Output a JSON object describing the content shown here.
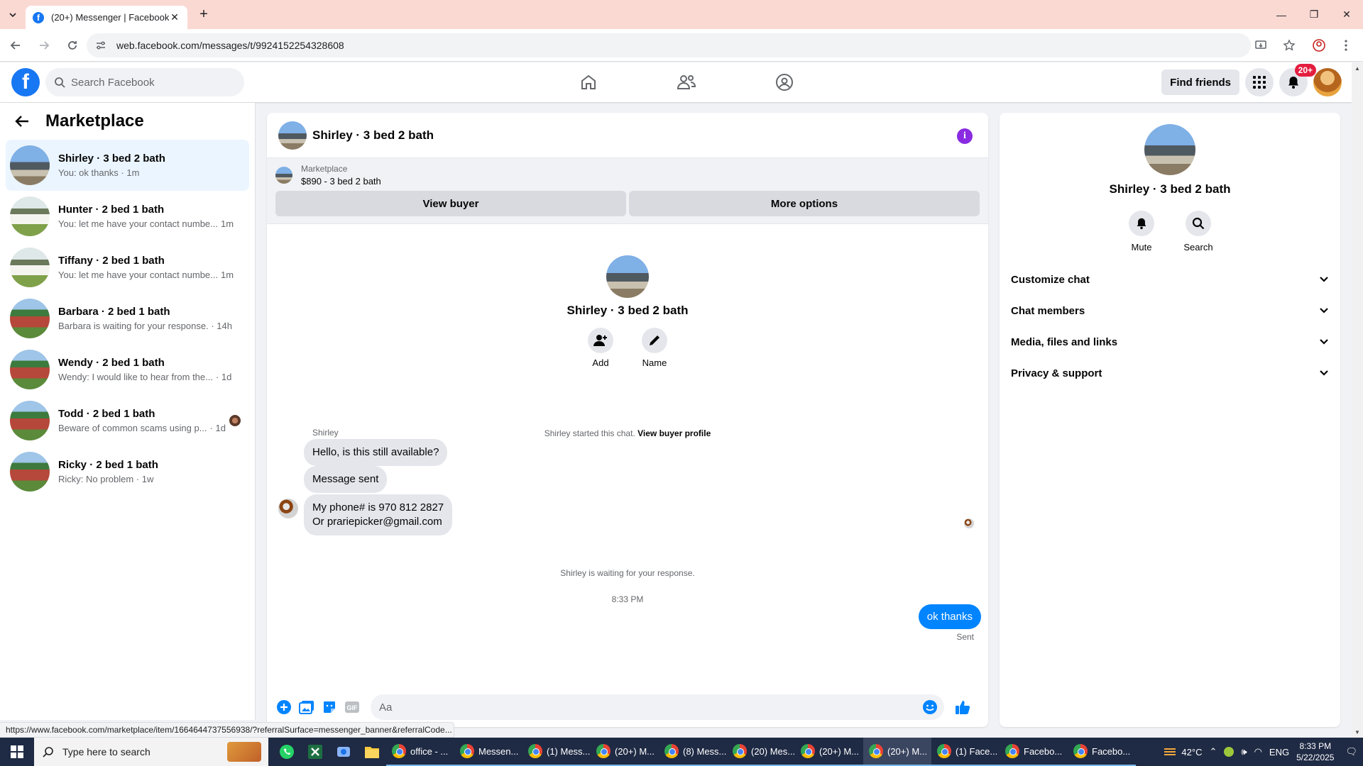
{
  "browser": {
    "tab_title": "(20+) Messenger | Facebook",
    "url": "web.facebook.com/messages/t/9924152254328608"
  },
  "header": {
    "search_placeholder": "Search Facebook",
    "find_friends": "Find friends",
    "notifications_badge": "20+"
  },
  "sidebar": {
    "title": "Marketplace",
    "conversations": [
      {
        "name": "Shirley · 3 bed 2 bath",
        "snippet": "You: ok thanks · 1m",
        "thumb": "house-a",
        "active": true
      },
      {
        "name": "Hunter · 2 bed 1 bath",
        "snippet": "You: let me have your contact numbe...",
        "time": "1m",
        "thumb": "house-b"
      },
      {
        "name": "Tiffany · 2 bed 1 bath",
        "snippet": "You: let me have your contact numbe...",
        "time": "1m",
        "thumb": "house-b"
      },
      {
        "name": "Barbara · 2 bed 1 bath",
        "snippet": "Barbara is waiting for your response. · 14h",
        "thumb": "house-c"
      },
      {
        "name": "Wendy · 2 bed 1 bath",
        "snippet": "Wendy: I would like to hear from the...",
        "time": "· 1d",
        "thumb": "house-c"
      },
      {
        "name": "Todd · 2 bed 1 bath",
        "snippet": "Beware of common scams using p...",
        "time": "· 1d",
        "thumb": "house-c"
      },
      {
        "name": "Ricky · 2 bed 1 bath",
        "snippet": "Ricky: No problem · 1w",
        "thumb": "house-c"
      }
    ]
  },
  "chat": {
    "title": "Shirley · 3 bed 2 bath",
    "banner_label": "Marketplace",
    "banner_sub": "$890 - 3 bed 2 bath",
    "view_buyer": "View buyer",
    "more_options": "More options",
    "intro_name": "Shirley · 3 bed 2 bath",
    "add_label": "Add",
    "name_label": "Name",
    "started_text": "Shirley started this chat.",
    "view_buyer_profile": "View buyer profile",
    "sender": "Shirley",
    "messages": [
      "Hello, is this still available?",
      "Message sent",
      "My phone# is 970 812 2827",
      "Or prariepicker@gmail.com"
    ],
    "waiting_text": "Shirley is waiting for your response.",
    "timestamp": "8:33 PM",
    "my_message": "ok thanks",
    "sent_label": "Sent",
    "input_placeholder": "Aa"
  },
  "details": {
    "name": "Shirley · 3 bed 2 bath",
    "mute": "Mute",
    "search": "Search",
    "sections": [
      "Customize chat",
      "Chat members",
      "Media, files and links",
      "Privacy & support"
    ]
  },
  "statusbar": "https://www.facebook.com/marketplace/item/1664644737556938/?referralSurface=messenger_banner&referralCode...",
  "taskbar": {
    "search_placeholder": "Type here to search",
    "tasks": [
      "office - ...",
      "Messen...",
      "(1) Mess...",
      "(20+) M...",
      "(8) Mess...",
      "(20) Mes...",
      "(20+) M...",
      "(20+) M...",
      "(1) Face...",
      "Facebo...",
      "Facebo..."
    ],
    "weather": "42°C",
    "lang": "ENG",
    "time": "8:33 PM",
    "date": "5/22/2025"
  },
  "colors": {
    "facebook_blue": "#1877f2",
    "messenger_blue": "#0084ff",
    "active_conv": "#ebf5ff",
    "info_purple": "#8a2be2"
  }
}
